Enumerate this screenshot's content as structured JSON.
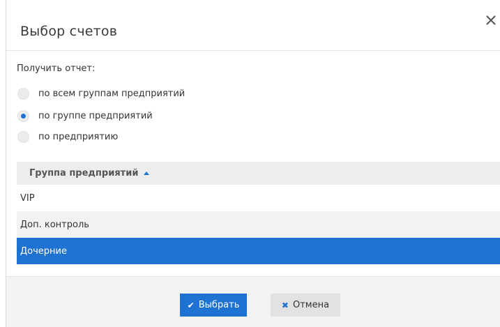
{
  "dialog": {
    "title": "Выбор счетов",
    "close_icon": "close-icon"
  },
  "report": {
    "label": "Получить отчет:",
    "options": [
      {
        "label": "по всем группам предприятий",
        "checked": false
      },
      {
        "label": "по группе предприятий",
        "checked": true
      },
      {
        "label": "по предприятию",
        "checked": false
      }
    ]
  },
  "table": {
    "column_header": "Группа предприятий",
    "sort_icon": "sort-ascending-icon",
    "rows": [
      {
        "label": "VIP",
        "selected": false
      },
      {
        "label": "Доп. контроль",
        "selected": false
      },
      {
        "label": "Дочерние",
        "selected": true
      }
    ]
  },
  "footer": {
    "select_label": "Выбрать",
    "select_icon": "check-icon",
    "cancel_label": "Отмена",
    "cancel_icon": "x-icon"
  },
  "colors": {
    "accent": "#1e73d2",
    "header_bg": "#ededed",
    "alt_row_bg": "#f2f2f2",
    "footer_bg": "#f3f3f3"
  }
}
